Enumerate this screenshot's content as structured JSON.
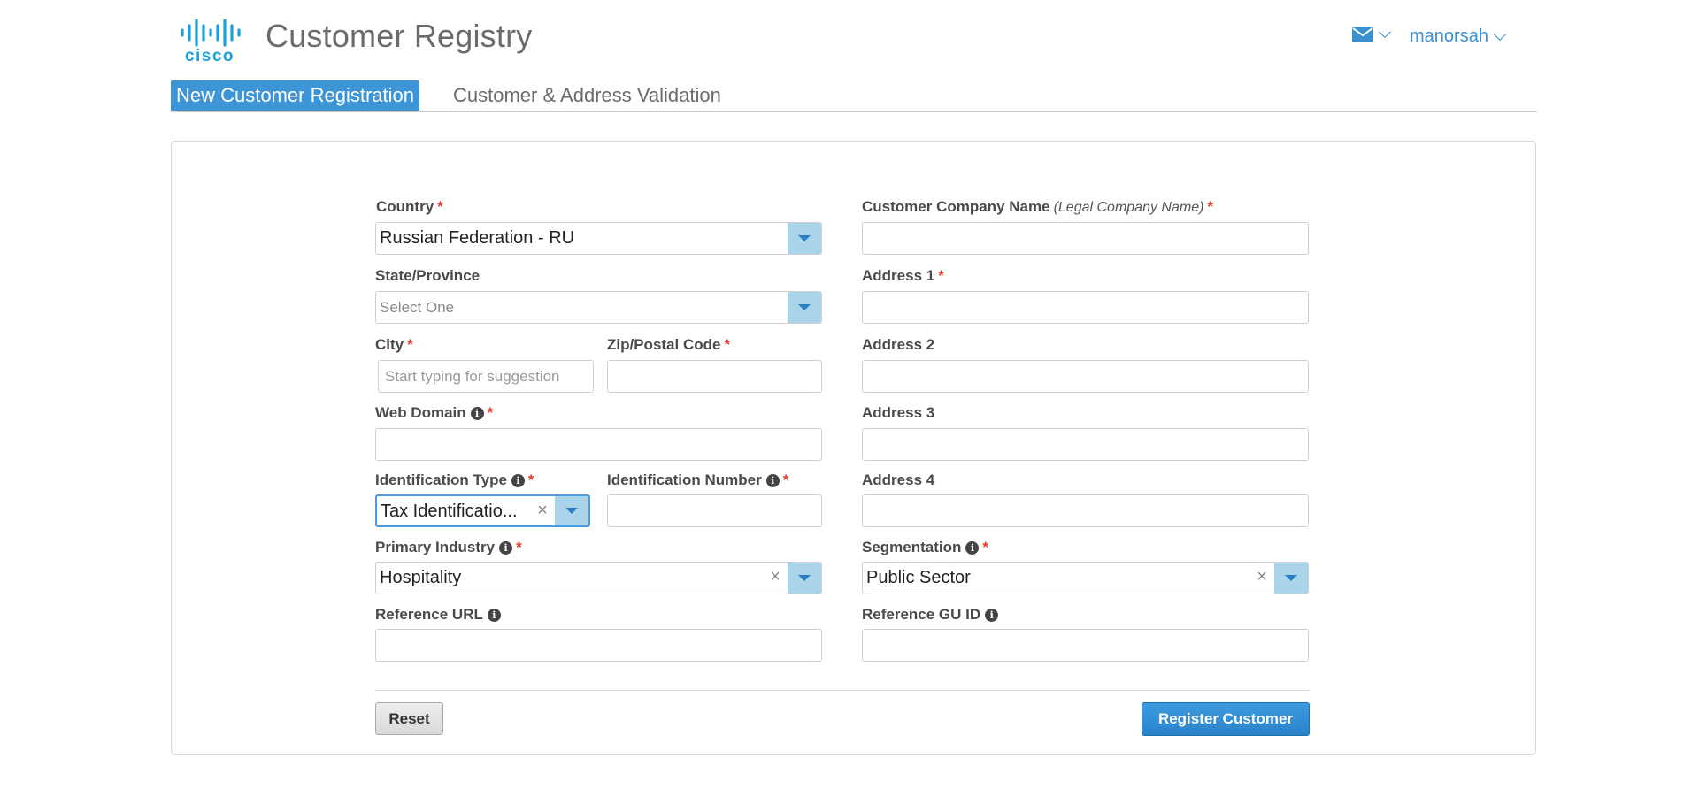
{
  "header": {
    "logo_text": "cisco",
    "app_title": "Customer Registry",
    "username": "manorsah"
  },
  "tabs": [
    {
      "label": "New Customer Registration",
      "active": true
    },
    {
      "label": "Customer & Address Validation",
      "active": false
    }
  ],
  "form": {
    "country": {
      "label": "Country",
      "value": "Russian Federation - RU"
    },
    "state": {
      "label": "State/Province",
      "placeholder": "Select One"
    },
    "city": {
      "label": "City",
      "placeholder": "Start typing for suggestion"
    },
    "zip": {
      "label": "Zip/Postal Code",
      "value": ""
    },
    "web_domain": {
      "label": "Web Domain",
      "value": ""
    },
    "id_type": {
      "label": "Identification Type",
      "value": "Tax Identificatio..."
    },
    "id_number": {
      "label": "Identification Number",
      "value": ""
    },
    "primary_industry": {
      "label": "Primary Industry",
      "value": "Hospitality"
    },
    "reference_url": {
      "label": "Reference URL",
      "value": ""
    },
    "company_name": {
      "label": "Customer Company Name",
      "hint": "(Legal Company Name)",
      "value": ""
    },
    "address1": {
      "label": "Address 1",
      "value": ""
    },
    "address2": {
      "label": "Address 2",
      "value": ""
    },
    "address3": {
      "label": "Address 3",
      "value": ""
    },
    "address4": {
      "label": "Address 4",
      "value": ""
    },
    "segmentation": {
      "label": "Segmentation",
      "value": "Public Sector"
    },
    "reference_gu_id": {
      "label": "Reference GU ID",
      "value": ""
    },
    "required_mark": "*",
    "info_glyph": "i",
    "clear_glyph": "×"
  },
  "buttons": {
    "reset": "Reset",
    "register": "Register Customer"
  },
  "colors": {
    "accent": "#3d94d6",
    "required": "#e5372b",
    "logo": "#1ba0d7",
    "dropdown_arrow_bg": "#a9d4e9"
  }
}
